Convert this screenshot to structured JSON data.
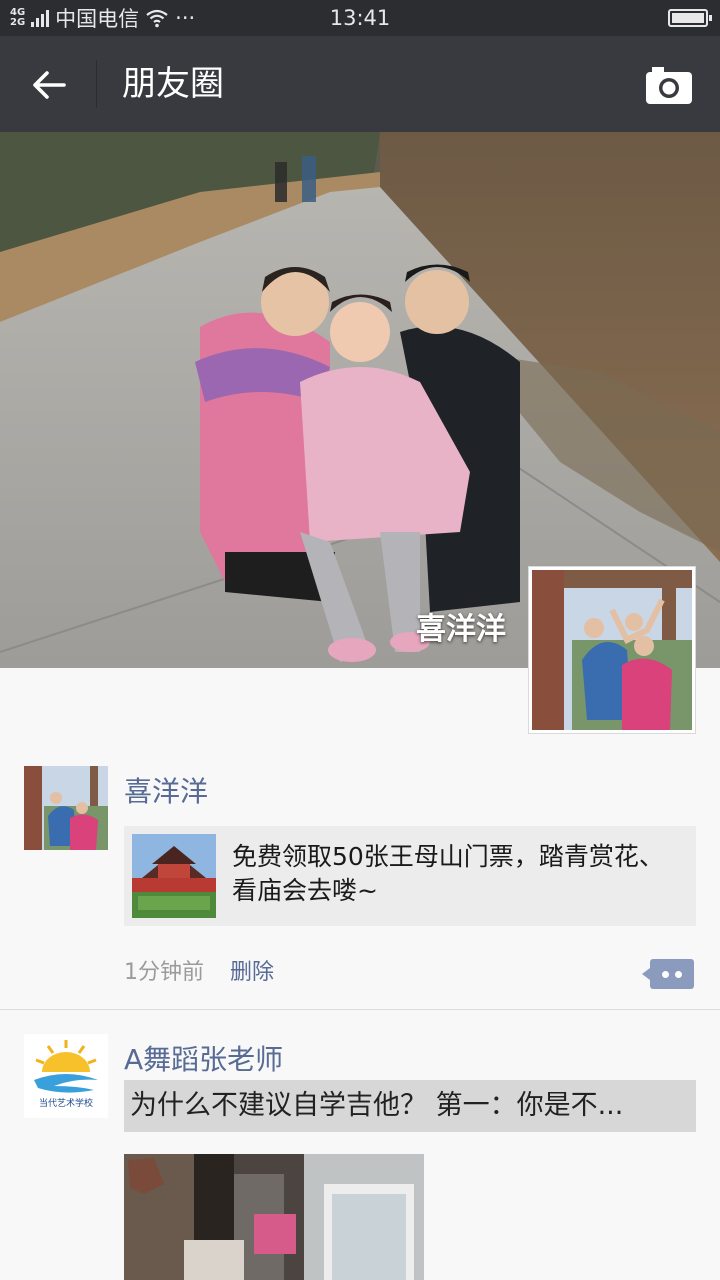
{
  "status_bar": {
    "network_top": "4G",
    "network_bottom": "2G",
    "carrier": "中国电信",
    "more": "···",
    "time": "13:41"
  },
  "nav": {
    "title": "朋友圈",
    "back_icon": "back-arrow-icon",
    "camera_icon": "camera-icon"
  },
  "profile": {
    "name": "喜洋洋"
  },
  "posts": [
    {
      "author": "喜洋洋",
      "link_text": "免费领取50张王母山门票，踏青赏花、看庙会去喽~",
      "time": "1分钟前",
      "delete_label": "删除"
    },
    {
      "author": "A舞蹈张老师",
      "text": "为什么不建议自学吉他？ 第一：你是不...",
      "avatar_caption": "当代艺术学校"
    }
  ],
  "colors": {
    "nav_bg": "#393a3f",
    "status_bg": "#2b2d31",
    "name_link": "#576b95",
    "page_bg": "#f8f8f8"
  }
}
